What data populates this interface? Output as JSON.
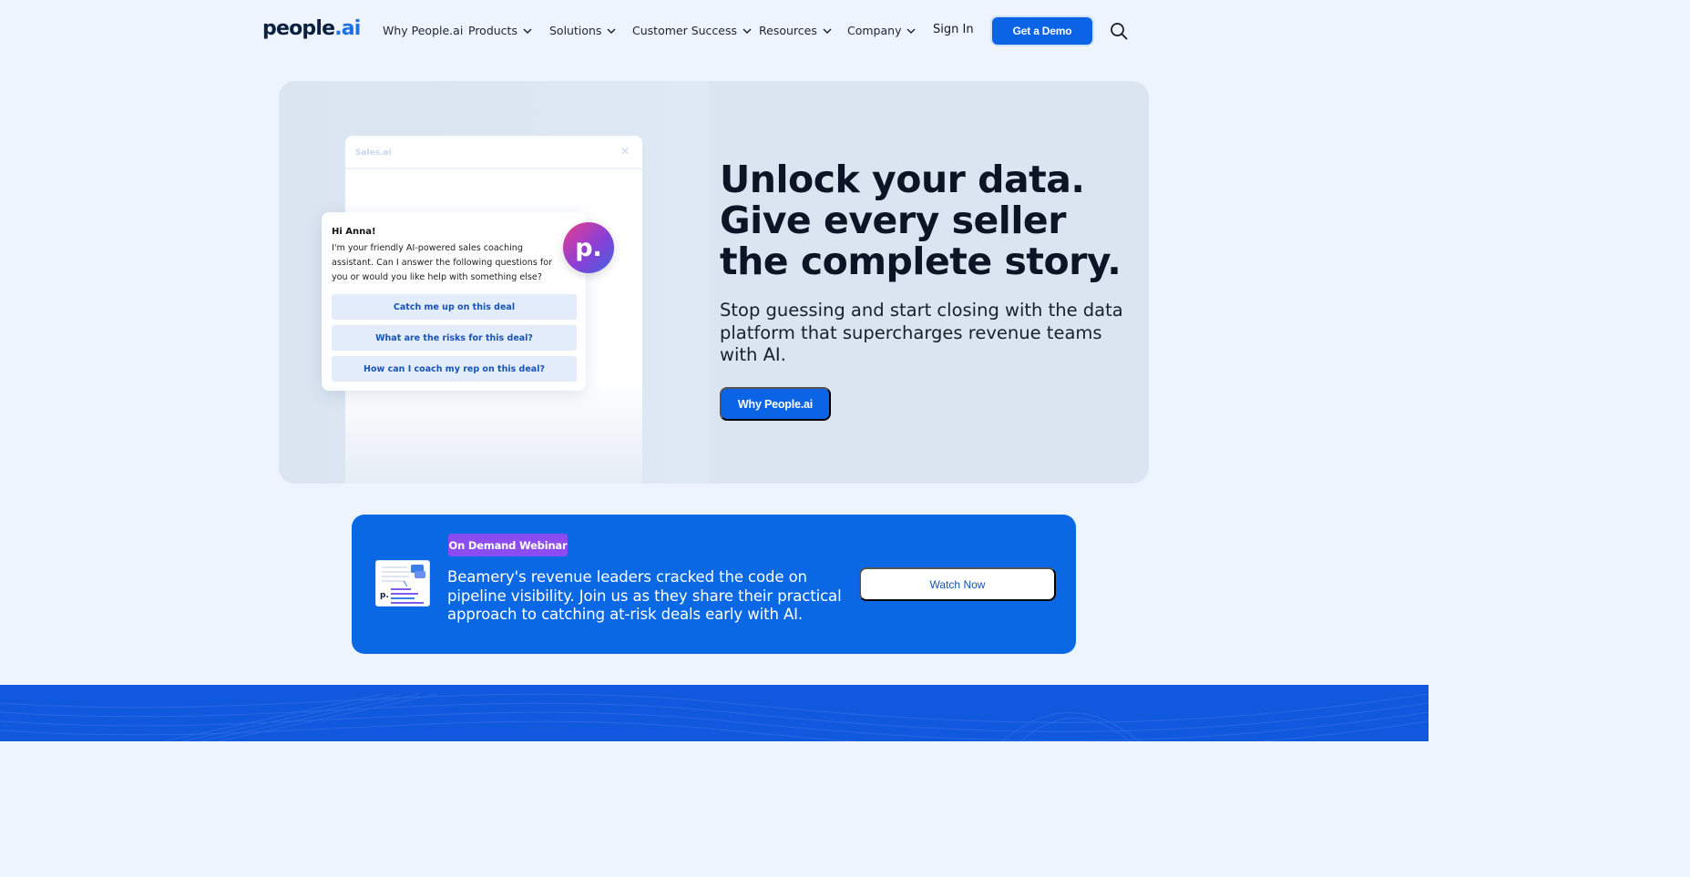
{
  "brand": {
    "logo_main": "people",
    "logo_accent": ".ai"
  },
  "nav": {
    "items": [
      {
        "label": "Why People.ai",
        "dropdown": false
      },
      {
        "label": "Products",
        "dropdown": true
      },
      {
        "label": "Solutions",
        "dropdown": true
      },
      {
        "label": "Customer Success",
        "dropdown": true
      },
      {
        "label": "Resources",
        "dropdown": true
      },
      {
        "label": "Company",
        "dropdown": true
      }
    ],
    "sign_in": "Sign In",
    "cta": "Get a Demo",
    "search_icon": "search-icon"
  },
  "hero": {
    "mock_app_title": "Sales.ai",
    "chat": {
      "greeting": "Hi Anna!",
      "body": "I'm your friendly AI-powered sales coaching assistant. Can I answer the following questions for you or would you like help with something else?",
      "options": [
        "Catch me up on this deal",
        "What are the risks for this deal?",
        "How can I coach my rep on this deal?"
      ],
      "avatar_letter": "p."
    },
    "headline": "Unlock your data. Give every seller the complete story.",
    "subheadline": "Stop guessing and start closing with the data platform that supercharges revenue teams with AI.",
    "button": "Why People.ai"
  },
  "webinar": {
    "badge": "On Demand Webinar",
    "text": "Beamery's revenue leaders cracked the code on pipeline visibility. Join us as they share their practical approach to catching at-risk deals early with AI.",
    "button": "Watch Now"
  },
  "colors": {
    "primary": "#0b63e5",
    "badge": "#8b4cf1",
    "page_bg": "#edf4fd",
    "hero_bg": "#dbe5f1"
  }
}
